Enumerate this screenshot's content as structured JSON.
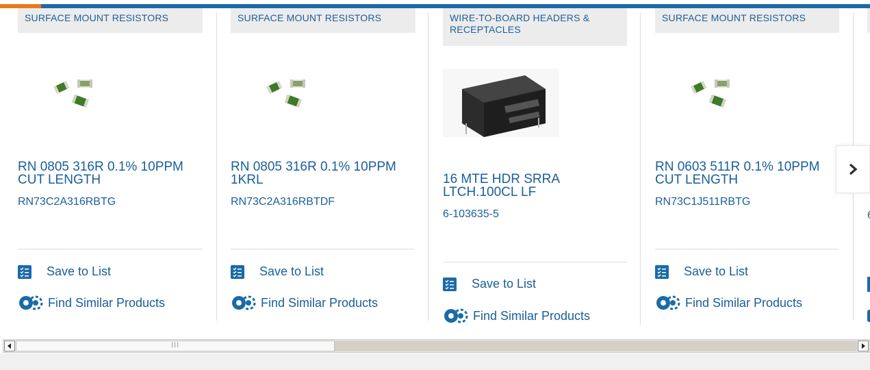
{
  "colors": {
    "accent": "#1a6ba8",
    "orange": "#e87a1a",
    "link": "#1a5e9a"
  },
  "cards": [
    {
      "category": "SURFACE MOUNT RESISTORS",
      "name": "RN 0805 316R 0.1% 10PPM CUT LENGTH",
      "part_number": "RN73C2A316RBTG",
      "image": "smd-resistors-image",
      "save_label": "Save to List",
      "similar_label": "Find Similar Products"
    },
    {
      "category": "SURFACE MOUNT RESISTORS",
      "name": "RN 0805 316R 0.1% 10PPM 1KRL",
      "part_number": "RN73C2A316RBTDF",
      "image": "smd-resistors-image",
      "save_label": "Save to List",
      "similar_label": "Find Similar Products"
    },
    {
      "category": "WIRE-TO-BOARD HEADERS & RECEPTACLES",
      "name": "16 MTE HDR SRRA LTCH.100CL LF",
      "part_number": "6-103635-5",
      "image": "header-connector-image",
      "save_label": "Save to List",
      "similar_label": "Find Similar Products"
    },
    {
      "category": "SURFACE MOUNT RESISTORS",
      "name": "RN 0603 511R 0.1% 10PPM CUT LENGTH",
      "part_number": "RN73C1J511RBTG",
      "image": "smd-resistors-image",
      "save_label": "Save to List",
      "similar_label": "Find Similar Products"
    }
  ],
  "partial_card": {
    "part_number_fragment": "6"
  },
  "next_button": {
    "icon": "chevron-right-icon"
  },
  "scrollbar": {
    "left_arrow": "scroll-left-arrow",
    "right_arrow": "scroll-right-arrow",
    "grip": "III"
  }
}
